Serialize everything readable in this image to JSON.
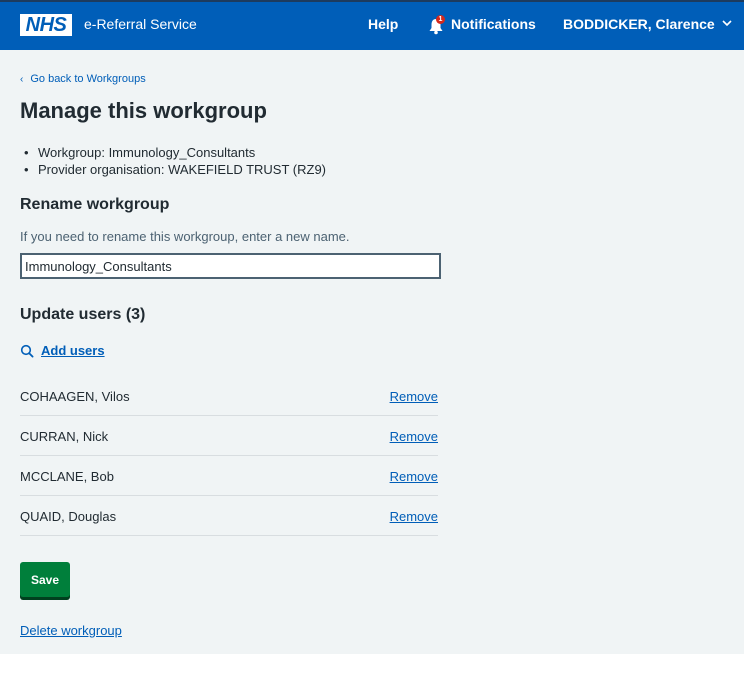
{
  "header": {
    "logo_text": "NHS",
    "service_name": "e-Referral Service",
    "help_label": "Help",
    "notifications_label": "Notifications",
    "notifications_count": "1",
    "user_name": "BODDICKER, Clarence",
    "brand_color": "#005eb8"
  },
  "main": {
    "back_link": "Go back to Workgroups",
    "title": "Manage this workgroup",
    "summary": [
      "Workgroup: Immunology_Consultants",
      "Provider organisation: WAKEFIELD TRUST (RZ9)"
    ],
    "rename": {
      "heading": "Rename workgroup",
      "hint": "If you need to rename this workgroup, enter a new name.",
      "value": "Immunology_Consultants"
    },
    "users": {
      "heading": "Update users (3)",
      "add_label": "Add users",
      "remove_label": "Remove",
      "list": [
        "COHAAGEN, Vilos",
        "CURRAN, Nick",
        "MCCLANE, Bob",
        "QUAID, Douglas"
      ]
    },
    "save_label": "Save",
    "delete_label": "Delete workgroup",
    "action_color": "#007f3b"
  }
}
